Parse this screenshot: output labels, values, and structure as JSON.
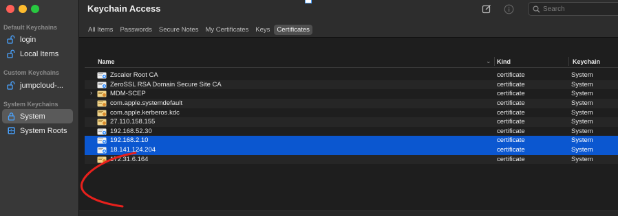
{
  "app": {
    "title": "Keychain Access"
  },
  "sidebar": {
    "sections": [
      {
        "label": "Default Keychains",
        "items": [
          {
            "label": "login",
            "icon": "unlocked-icon",
            "selected": false
          },
          {
            "label": "Local Items",
            "icon": "unlocked-icon",
            "selected": false
          }
        ]
      },
      {
        "label": "Custom Keychains",
        "items": [
          {
            "label": "jumpcloud-...",
            "icon": "unlocked-icon",
            "selected": false
          }
        ]
      },
      {
        "label": "System Keychains",
        "items": [
          {
            "label": "System",
            "icon": "locked-icon",
            "selected": true
          },
          {
            "label": "System Roots",
            "icon": "cabinet-icon",
            "selected": false
          }
        ]
      }
    ]
  },
  "toolbar": {
    "search_placeholder": "Search"
  },
  "tabs": [
    {
      "label": "All Items",
      "active": false
    },
    {
      "label": "Passwords",
      "active": false
    },
    {
      "label": "Secure Notes",
      "active": false
    },
    {
      "label": "My Certificates",
      "active": false
    },
    {
      "label": "Keys",
      "active": false
    },
    {
      "label": "Certificates",
      "active": true
    }
  ],
  "table": {
    "columns": {
      "name": "Name",
      "kind": "Kind",
      "keychain": "Keychain"
    },
    "rows": [
      {
        "name": "Zscaler Root CA",
        "kind": "certificate",
        "keychain": "System",
        "selected": false,
        "expandable": false,
        "icon": "root-certificate-icon"
      },
      {
        "name": "ZeroSSL RSA Domain Secure Site CA",
        "kind": "certificate",
        "keychain": "System",
        "selected": false,
        "expandable": false,
        "icon": "intermediate-certificate-icon"
      },
      {
        "name": "MDM-SCEP",
        "kind": "certificate",
        "keychain": "System",
        "selected": false,
        "expandable": true,
        "icon": "certificate-icon"
      },
      {
        "name": "com.apple.systemdefault",
        "kind": "certificate",
        "keychain": "System",
        "selected": false,
        "expandable": false,
        "icon": "certificate-icon"
      },
      {
        "name": "com.apple.kerberos.kdc",
        "kind": "certificate",
        "keychain": "System",
        "selected": false,
        "expandable": false,
        "icon": "certificate-icon"
      },
      {
        "name": "27.110.158.155",
        "kind": "certificate",
        "keychain": "System",
        "selected": false,
        "expandable": false,
        "icon": "certificate-icon"
      },
      {
        "name": "192.168.52.30",
        "kind": "certificate",
        "keychain": "System",
        "selected": false,
        "expandable": false,
        "icon": "certificate-icon"
      },
      {
        "name": "192.168.2.10",
        "kind": "certificate",
        "keychain": "System",
        "selected": true,
        "expandable": false,
        "icon": "certificate-icon"
      },
      {
        "name": "18.141.124.204",
        "kind": "certificate",
        "keychain": "System",
        "selected": true,
        "expandable": false,
        "icon": "certificate-icon"
      },
      {
        "name": "172.31.6.164",
        "kind": "certificate",
        "keychain": "System",
        "selected": false,
        "expandable": false,
        "icon": "certificate-icon"
      }
    ]
  },
  "colors": {
    "selection": "#0b57d0",
    "annotation": "#e8201c",
    "traffic_red": "#ff5f57",
    "traffic_yellow": "#febc2e",
    "traffic_green": "#28c840"
  }
}
